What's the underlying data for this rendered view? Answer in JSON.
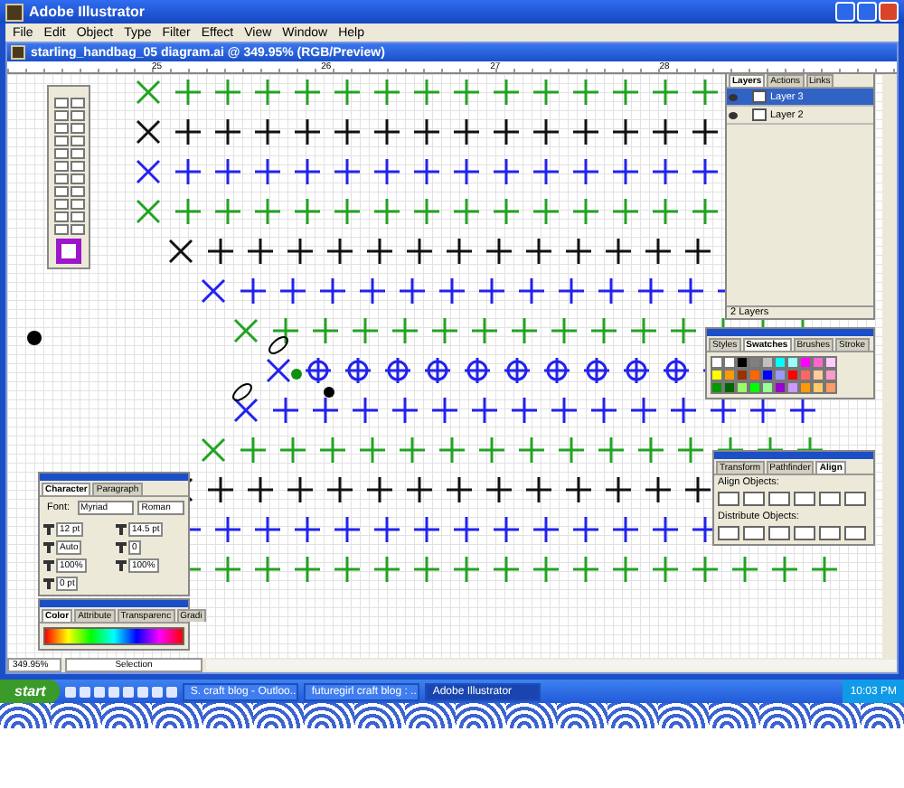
{
  "window": {
    "title": "Adobe Illustrator"
  },
  "menu": [
    "File",
    "Edit",
    "Object",
    "Type",
    "Filter",
    "Effect",
    "View",
    "Window",
    "Help"
  ],
  "document": {
    "title": "starling_handbag_05 diagram.ai @ 349.95% (RGB/Preview)",
    "ruler_labels": [
      "25",
      "26",
      "27",
      "28"
    ]
  },
  "layers_panel": {
    "tabs": [
      {
        "label": "Layers",
        "selected": true
      },
      {
        "label": "Actions",
        "selected": false
      },
      {
        "label": "Links",
        "selected": false
      }
    ],
    "layers": [
      {
        "name": "Layer 3",
        "selected": true
      },
      {
        "name": "Layer 2",
        "selected": false
      }
    ],
    "count": "2 Layers"
  },
  "swatches_panel": {
    "tabs": [
      {
        "label": "Styles",
        "selected": false
      },
      {
        "label": "Swatches",
        "selected": true
      },
      {
        "label": "Brushes",
        "selected": false
      },
      {
        "label": "Stroke",
        "selected": false
      }
    ],
    "swatches": [
      {
        "color": "#ffffff"
      },
      {
        "color": "#ffffff"
      },
      {
        "color": "#000000"
      },
      {
        "color": "#808080"
      },
      {
        "color": "#c0c0c0"
      },
      {
        "color": "#00ffff"
      },
      {
        "color": "#99ffff"
      },
      {
        "color": "#ff00ff"
      },
      {
        "color": "#ff66cc"
      },
      {
        "color": "#ffccff"
      },
      {
        "color": "#ffff00"
      },
      {
        "color": "#ff9900"
      },
      {
        "color": "#993300"
      },
      {
        "color": "#ff6600"
      },
      {
        "color": "#0000ff"
      },
      {
        "color": "#9999ff"
      },
      {
        "color": "#ff0000"
      },
      {
        "color": "#ff6666"
      },
      {
        "color": "#ffcc99"
      },
      {
        "color": "#ff99cc"
      },
      {
        "color": "#009900"
      },
      {
        "color": "#006600"
      },
      {
        "color": "#99ff66"
      },
      {
        "color": "#00ff00"
      },
      {
        "color": "#99ff99"
      },
      {
        "color": "#9900cc"
      },
      {
        "color": "#cc99ff"
      },
      {
        "color": "#ff9900"
      },
      {
        "color": "#ffcc66"
      },
      {
        "color": "#ff9966"
      }
    ]
  },
  "align_panel": {
    "tabs": [
      {
        "label": "Transform",
        "selected": false
      },
      {
        "label": "Pathfinder",
        "selected": false
      },
      {
        "label": "Align",
        "selected": true
      }
    ],
    "sections": [
      "Align Objects:",
      "Distribute Objects:"
    ]
  },
  "character_panel": {
    "tabs": [
      {
        "label": "Character",
        "selected": true
      },
      {
        "label": "Paragraph",
        "selected": false
      }
    ],
    "font_label": "Font:",
    "font": "Myriad",
    "style": "Roman",
    "fields": [
      "12 pt",
      "14.5 pt",
      "Auto",
      "0",
      "100%",
      "100%",
      "0 pt"
    ]
  },
  "color_panel": {
    "tabs": [
      {
        "label": "Color",
        "selected": true
      },
      {
        "label": "Attribute",
        "selected": false
      },
      {
        "label": "Transparenc",
        "selected": false
      },
      {
        "label": "Gradi",
        "selected": false
      }
    ]
  },
  "status_bar": {
    "zoom": "349.95%",
    "tool": "Selection"
  },
  "taskbar": {
    "start": "start",
    "tasks": [
      {
        "label": "S. craft blog - Outloo...",
        "selected": false
      },
      {
        "label": "futuregirl craft blog : ...",
        "selected": false
      },
      {
        "label": "Adobe Illustrator",
        "selected": true
      }
    ],
    "clock": "10:03 PM"
  }
}
